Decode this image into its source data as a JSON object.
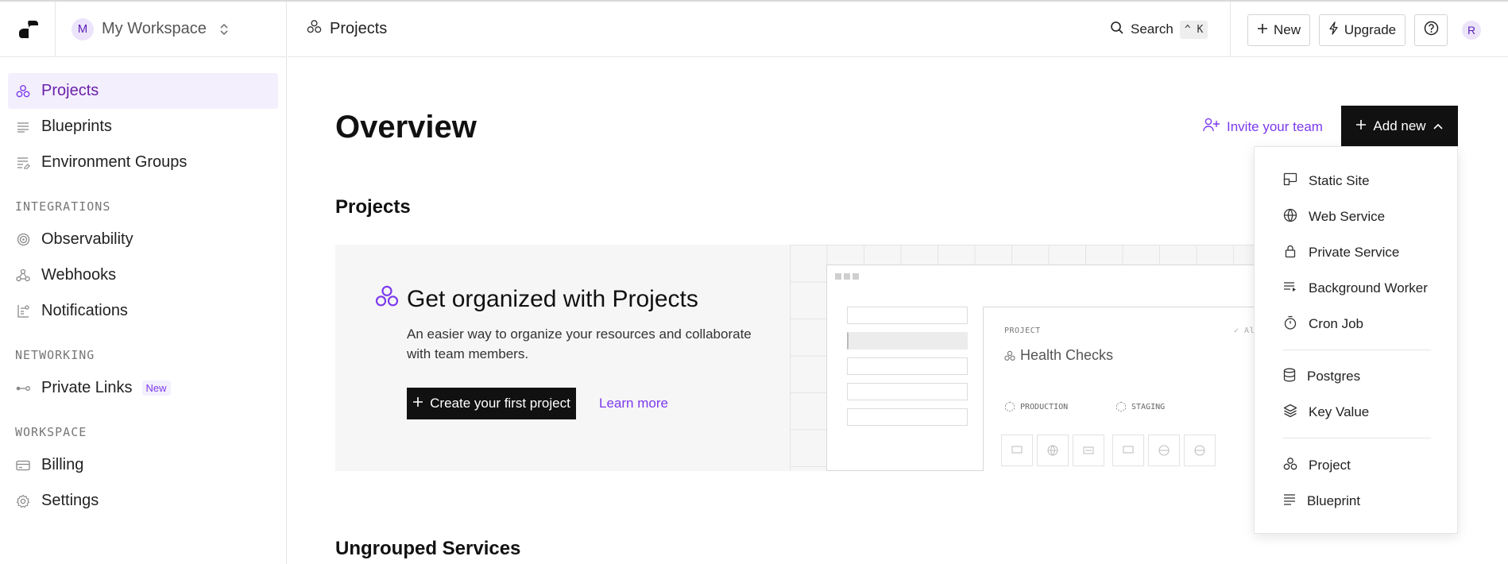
{
  "sidebar": {
    "workspace": {
      "avatar_letter": "M",
      "name": "My Workspace"
    },
    "items": [
      {
        "label": "Projects",
        "icon": "projects-icon",
        "active": true
      },
      {
        "label": "Blueprints",
        "icon": "blueprints-icon"
      },
      {
        "label": "Environment Groups",
        "icon": "env-groups-icon"
      }
    ],
    "integrations_label": "INTEGRATIONS",
    "integrations": [
      {
        "label": "Observability",
        "icon": "observability-icon"
      },
      {
        "label": "Webhooks",
        "icon": "webhooks-icon"
      },
      {
        "label": "Notifications",
        "icon": "notifications-icon"
      }
    ],
    "networking_label": "NETWORKING",
    "networking": [
      {
        "label": "Private Links",
        "icon": "private-links-icon",
        "badge": "New"
      }
    ],
    "workspace_label": "WORKSPACE",
    "workspace_items": [
      {
        "label": "Billing",
        "icon": "billing-icon"
      },
      {
        "label": "Settings",
        "icon": "settings-icon"
      }
    ]
  },
  "topbar": {
    "title": "Projects",
    "search_label": "Search",
    "search_shortcut": "^ K",
    "new_label": "New",
    "upgrade_label": "Upgrade",
    "help_icon": "help-icon",
    "user_avatar": "R"
  },
  "main": {
    "title": "Overview",
    "invite_label": "Invite your team",
    "add_new_label": "Add new",
    "projects_heading": "Projects",
    "ungrouped_heading": "Ungrouped Services",
    "promo": {
      "title": "Get organized with Projects",
      "text": "An easier way to organize your resources and collaborate with team members.",
      "cta": "Create your first project",
      "learn_more": "Learn more",
      "illustration": {
        "project_label": "PROJECT",
        "project_name": "Health Checks",
        "all_label": "All",
        "env_production": "PRODUCTION",
        "env_staging": "STAGING"
      }
    }
  },
  "dropdown": {
    "groups": [
      [
        {
          "label": "Static Site",
          "icon": "static-site-icon"
        },
        {
          "label": "Web Service",
          "icon": "globe-icon"
        },
        {
          "label": "Private Service",
          "icon": "lock-icon"
        },
        {
          "label": "Background Worker",
          "icon": "worker-icon"
        },
        {
          "label": "Cron Job",
          "icon": "timer-icon"
        }
      ],
      [
        {
          "label": "Postgres",
          "icon": "database-icon"
        },
        {
          "label": "Key Value",
          "icon": "layers-icon"
        }
      ],
      [
        {
          "label": "Project",
          "icon": "projects-icon"
        },
        {
          "label": "Blueprint",
          "icon": "blueprint-icon"
        }
      ]
    ]
  },
  "colors": {
    "accent": "#7c3aed",
    "active_bg": "#f3effd",
    "dark": "#111111"
  }
}
